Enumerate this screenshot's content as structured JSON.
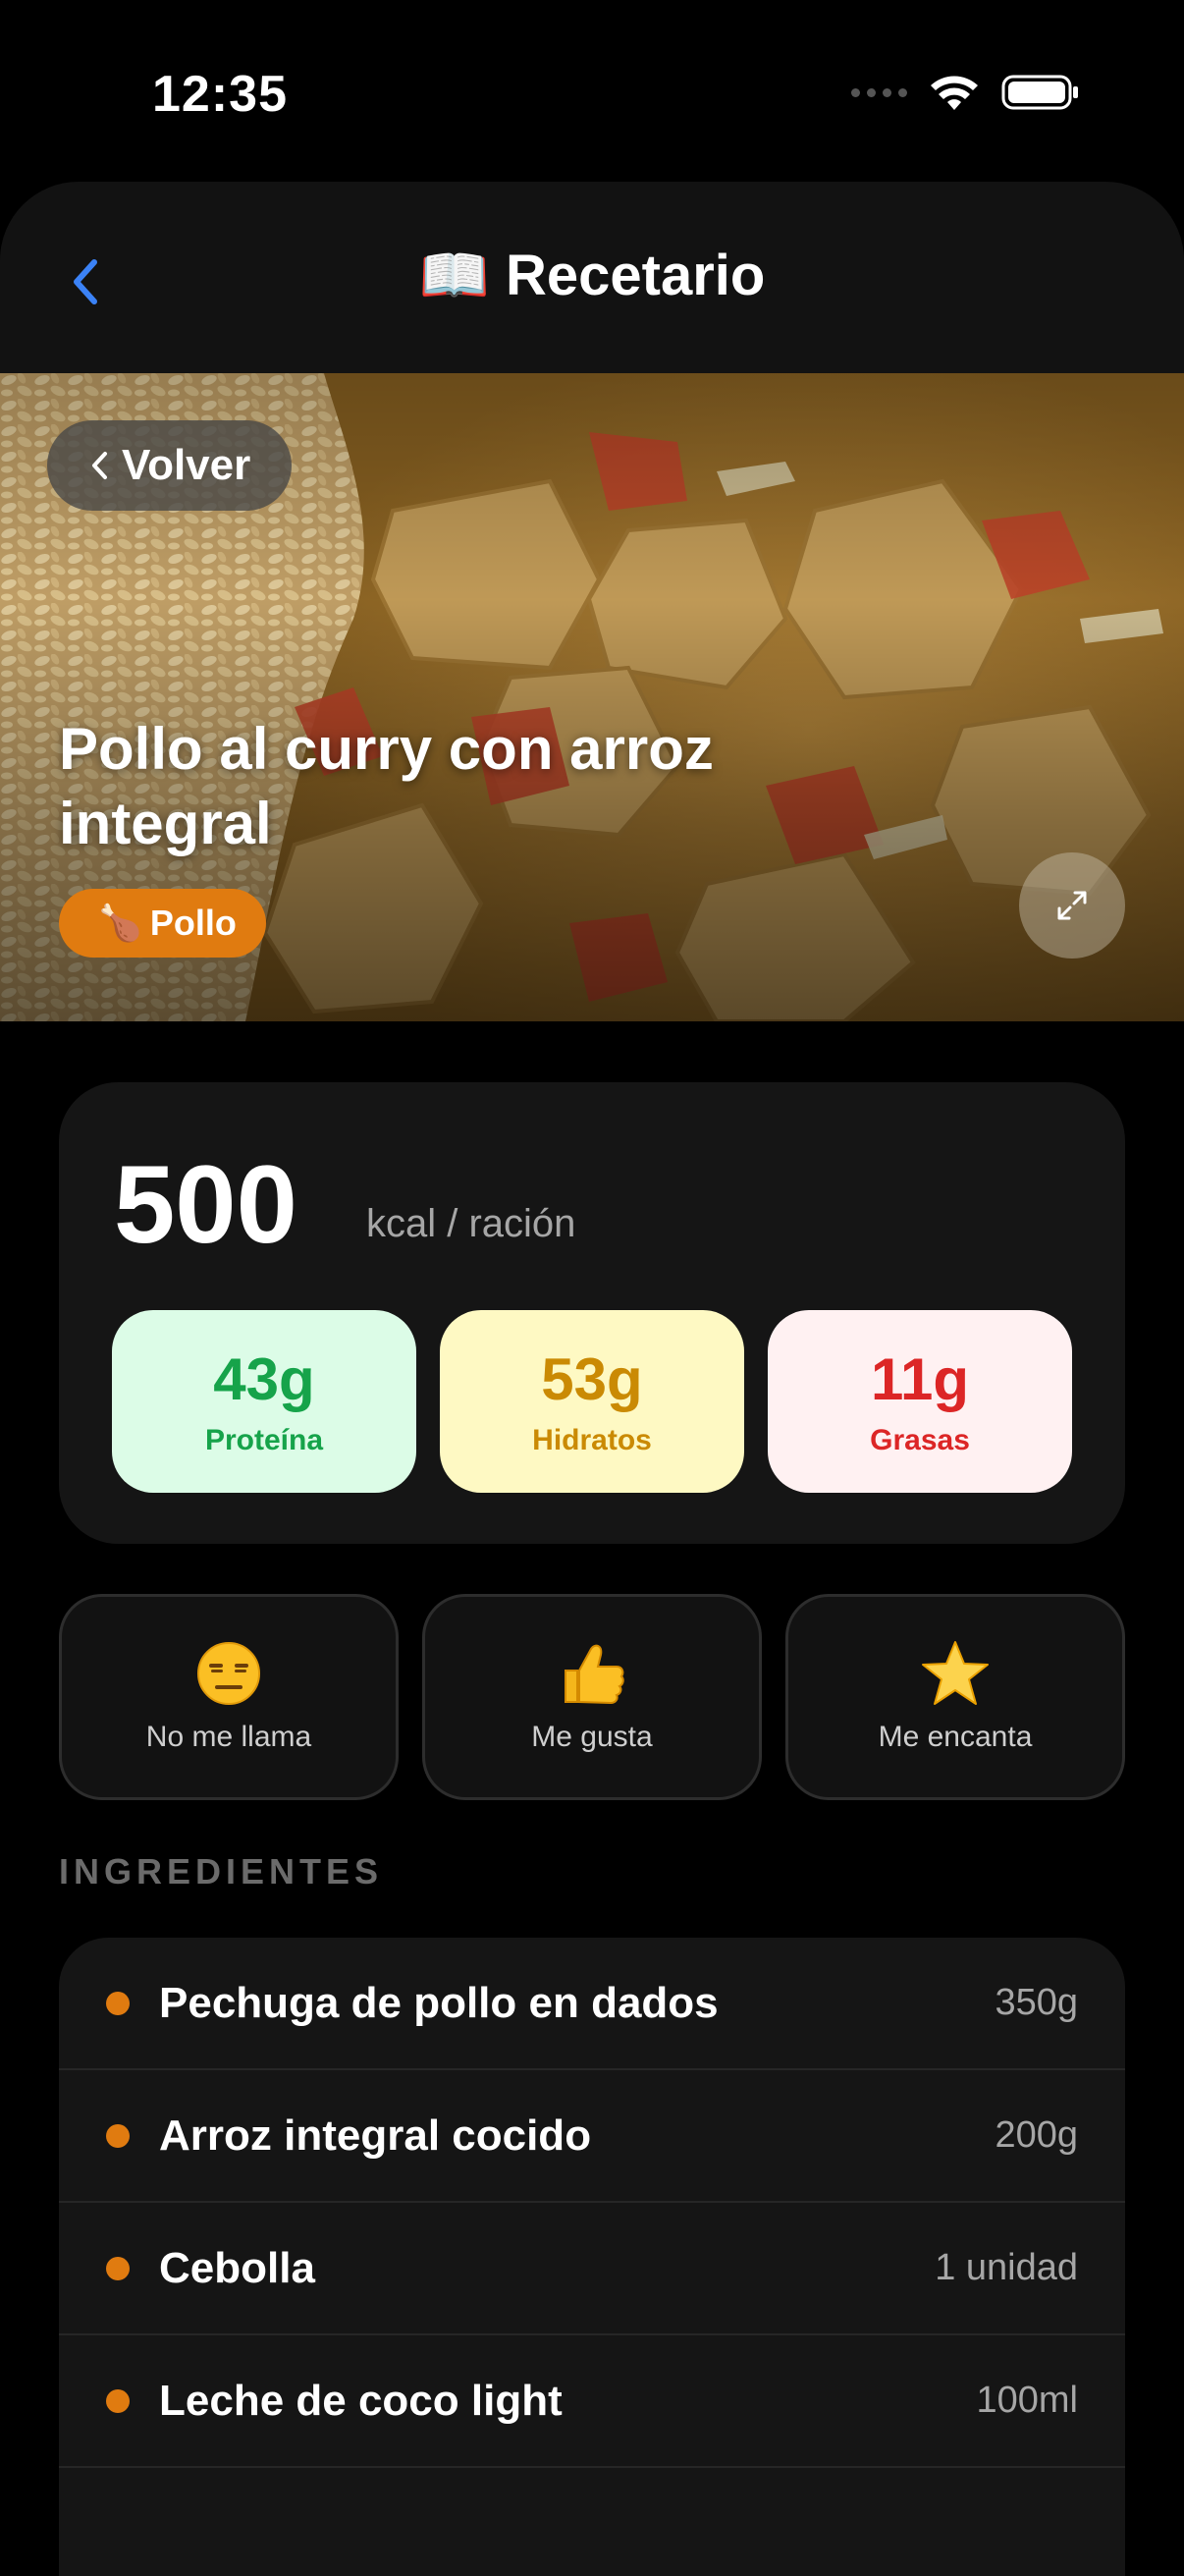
{
  "status": {
    "time": "12:35"
  },
  "nav": {
    "title": "📖 Recetario",
    "back_icon": "chevron-left-icon"
  },
  "hero": {
    "back_label": "Volver",
    "title": "Pollo al curry con arroz integral",
    "category_icon": "🍗",
    "category": "Pollo",
    "expand_icon": "expand-icon"
  },
  "nutrition": {
    "kcal": "500",
    "kcal_unit": "kcal / ración",
    "macros": [
      {
        "value": "43g",
        "label": "Proteína",
        "color": "#16a34a",
        "bg": "#dcfce7"
      },
      {
        "value": "53g",
        "label": "Hidratos",
        "color": "#ca8a04",
        "bg": "#fef9c3"
      },
      {
        "value": "11g",
        "label": "Grasas",
        "color": "#dc2626",
        "bg": "#fff1f2"
      }
    ]
  },
  "ratings": [
    {
      "emoji": "😑",
      "label": "No me llama"
    },
    {
      "emoji": "👍",
      "label": "Me gusta"
    },
    {
      "emoji": "⭐",
      "label": "Me encanta"
    }
  ],
  "ingredients": {
    "section_label": "INGREDIENTES",
    "items": [
      {
        "name": "Pechuga de pollo en dados",
        "qty": "350g"
      },
      {
        "name": "Arroz integral cocido",
        "qty": "200g"
      },
      {
        "name": "Cebolla",
        "qty": "1 unidad"
      },
      {
        "name": "Leche de coco light",
        "qty": "100ml"
      }
    ]
  },
  "colors": {
    "accent": "#e07b10",
    "nav_back": "#3b82f6"
  }
}
